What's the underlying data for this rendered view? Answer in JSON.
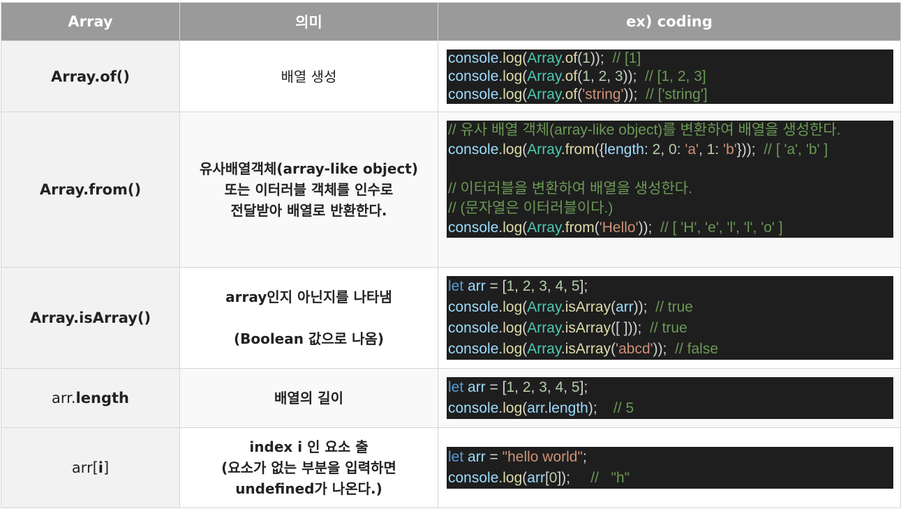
{
  "header": {
    "col1": "Array",
    "col2": "의미",
    "col3": "ex) coding"
  },
  "rows": [
    {
      "name_bold": "Array.of()",
      "meaning": [
        "배열 생성"
      ],
      "code": [
        [
          [
            "fn",
            "console"
          ],
          [
            "p",
            "."
          ],
          [
            "m",
            "log"
          ],
          [
            "p",
            "("
          ],
          [
            "cls",
            "Array"
          ],
          [
            "p",
            "."
          ],
          [
            "m",
            "of"
          ],
          [
            "p",
            "("
          ],
          [
            "n",
            "1"
          ],
          [
            "p",
            "));  "
          ],
          [
            "cm",
            "// [1]"
          ]
        ],
        [
          [
            "fn",
            "console"
          ],
          [
            "p",
            "."
          ],
          [
            "m",
            "log"
          ],
          [
            "p",
            "("
          ],
          [
            "cls",
            "Array"
          ],
          [
            "p",
            "."
          ],
          [
            "m",
            "of"
          ],
          [
            "p",
            "("
          ],
          [
            "n",
            "1"
          ],
          [
            "p",
            ", "
          ],
          [
            "n",
            "2"
          ],
          [
            "p",
            ", "
          ],
          [
            "n",
            "3"
          ],
          [
            "p",
            "));  "
          ],
          [
            "cm",
            "// [1, 2, 3]"
          ]
        ],
        [
          [
            "fn",
            "console"
          ],
          [
            "p",
            "."
          ],
          [
            "m",
            "log"
          ],
          [
            "p",
            "("
          ],
          [
            "cls",
            "Array"
          ],
          [
            "p",
            "."
          ],
          [
            "m",
            "of"
          ],
          [
            "p",
            "("
          ],
          [
            "s",
            "'string'"
          ],
          [
            "p",
            "));  "
          ],
          [
            "cm",
            "// ['string']"
          ]
        ]
      ]
    },
    {
      "name_bold": "Array.from()",
      "meaning": [
        "유사배열객체(array-like object)",
        "또는 이터러블 객체를 인수로",
        "전달받아 배열로 반환한다."
      ],
      "code": [
        [
          [
            "cm",
            "// 유사 배열 객체(array-like object)를 변환하여 배열을 생성한다."
          ]
        ],
        [
          [
            "fn",
            "console"
          ],
          [
            "p",
            "."
          ],
          [
            "m",
            "log"
          ],
          [
            "p",
            "("
          ],
          [
            "cls",
            "Array"
          ],
          [
            "p",
            "."
          ],
          [
            "m",
            "from"
          ],
          [
            "p",
            "({"
          ],
          [
            "fn",
            "length"
          ],
          [
            "p",
            ": "
          ],
          [
            "n",
            "2"
          ],
          [
            "p",
            ", "
          ],
          [
            "n",
            "0"
          ],
          [
            "p",
            ": "
          ],
          [
            "s",
            "'a'"
          ],
          [
            "p",
            ", "
          ],
          [
            "n",
            "1"
          ],
          [
            "p",
            ": "
          ],
          [
            "s",
            "'b'"
          ],
          [
            "p",
            "}));  "
          ],
          [
            "cm",
            "// [ 'a', 'b' ]"
          ]
        ],
        [
          [
            "p",
            " "
          ]
        ],
        [
          [
            "cm",
            "// 이터러블을 변환하여 배열을 생성한다."
          ]
        ],
        [
          [
            "cm",
            "// (문자열은 이터러블이다.)"
          ]
        ],
        [
          [
            "fn",
            "console"
          ],
          [
            "p",
            "."
          ],
          [
            "m",
            "log"
          ],
          [
            "p",
            "("
          ],
          [
            "cls",
            "Array"
          ],
          [
            "p",
            "."
          ],
          [
            "m",
            "from"
          ],
          [
            "p",
            "("
          ],
          [
            "s",
            "'Hello'"
          ],
          [
            "p",
            "));  "
          ],
          [
            "cm",
            "// [ 'H', 'e', 'l', 'l', 'o' ]"
          ]
        ]
      ]
    },
    {
      "name_bold": "Array.isArray()",
      "meaning": [
        "array인지 아닌지를 나타냄",
        " ",
        "(Boolean 값으로 나옴)"
      ],
      "code": [
        [
          [
            "kw",
            "let"
          ],
          [
            "p",
            " "
          ],
          [
            "fn",
            "arr"
          ],
          [
            "p",
            " = ["
          ],
          [
            "n",
            "1"
          ],
          [
            "p",
            ", "
          ],
          [
            "n",
            "2"
          ],
          [
            "p",
            ", "
          ],
          [
            "n",
            "3"
          ],
          [
            "p",
            ", "
          ],
          [
            "n",
            "4"
          ],
          [
            "p",
            ", "
          ],
          [
            "n",
            "5"
          ],
          [
            "p",
            "];"
          ]
        ],
        [
          [
            "fn",
            "console"
          ],
          [
            "p",
            "."
          ],
          [
            "m",
            "log"
          ],
          [
            "p",
            "("
          ],
          [
            "cls",
            "Array"
          ],
          [
            "p",
            "."
          ],
          [
            "m",
            "isArray"
          ],
          [
            "p",
            "("
          ],
          [
            "fn",
            "arr"
          ],
          [
            "p",
            "));  "
          ],
          [
            "cm",
            "// true"
          ]
        ],
        [
          [
            "fn",
            "console"
          ],
          [
            "p",
            "."
          ],
          [
            "m",
            "log"
          ],
          [
            "p",
            "("
          ],
          [
            "cls",
            "Array"
          ],
          [
            "p",
            "."
          ],
          [
            "m",
            "isArray"
          ],
          [
            "p",
            "([ ]));  "
          ],
          [
            "cm",
            "// true"
          ]
        ],
        [
          [
            "fn",
            "console"
          ],
          [
            "p",
            "."
          ],
          [
            "m",
            "log"
          ],
          [
            "p",
            "("
          ],
          [
            "cls",
            "Array"
          ],
          [
            "p",
            "."
          ],
          [
            "m",
            "isArray"
          ],
          [
            "p",
            "("
          ],
          [
            "s",
            "'abcd'"
          ],
          [
            "p",
            "));  "
          ],
          [
            "cm",
            "// false"
          ]
        ]
      ]
    },
    {
      "name_plain": "arr.",
      "name_bold": "length",
      "meaning": [
        "배열의 길이"
      ],
      "code": [
        [
          [
            "kw",
            "let"
          ],
          [
            "p",
            " "
          ],
          [
            "fn",
            "arr"
          ],
          [
            "p",
            " = ["
          ],
          [
            "n",
            "1"
          ],
          [
            "p",
            ", "
          ],
          [
            "n",
            "2"
          ],
          [
            "p",
            ", "
          ],
          [
            "n",
            "3"
          ],
          [
            "p",
            ", "
          ],
          [
            "n",
            "4"
          ],
          [
            "p",
            ", "
          ],
          [
            "n",
            "5"
          ],
          [
            "p",
            "];"
          ]
        ],
        [
          [
            "fn",
            "console"
          ],
          [
            "p",
            "."
          ],
          [
            "m",
            "log"
          ],
          [
            "p",
            "("
          ],
          [
            "fn",
            "arr"
          ],
          [
            "p",
            "."
          ],
          [
            "fn",
            "length"
          ],
          [
            "p",
            ");    "
          ],
          [
            "cm",
            "// 5"
          ]
        ]
      ]
    },
    {
      "name_plain": "arr[",
      "name_bold": "i",
      "name_plain2": "]",
      "meaning": [
        "index i 인 요소 출",
        "(요소가 없는 부분을 입력하면",
        "undefined가 나온다.)"
      ],
      "code": [
        [
          [
            "kw",
            "let"
          ],
          [
            "p",
            " "
          ],
          [
            "fn",
            "arr"
          ],
          [
            "p",
            " = "
          ],
          [
            "s",
            "\"hello world\""
          ],
          [
            "p",
            ";"
          ]
        ],
        [
          [
            "fn",
            "console"
          ],
          [
            "p",
            "."
          ],
          [
            "m",
            "log"
          ],
          [
            "p",
            "("
          ],
          [
            "fn",
            "arr"
          ],
          [
            "p",
            "["
          ],
          [
            "n",
            "0"
          ],
          [
            "p",
            "]);     "
          ],
          [
            "cm",
            "//   \"h\""
          ]
        ]
      ]
    }
  ]
}
